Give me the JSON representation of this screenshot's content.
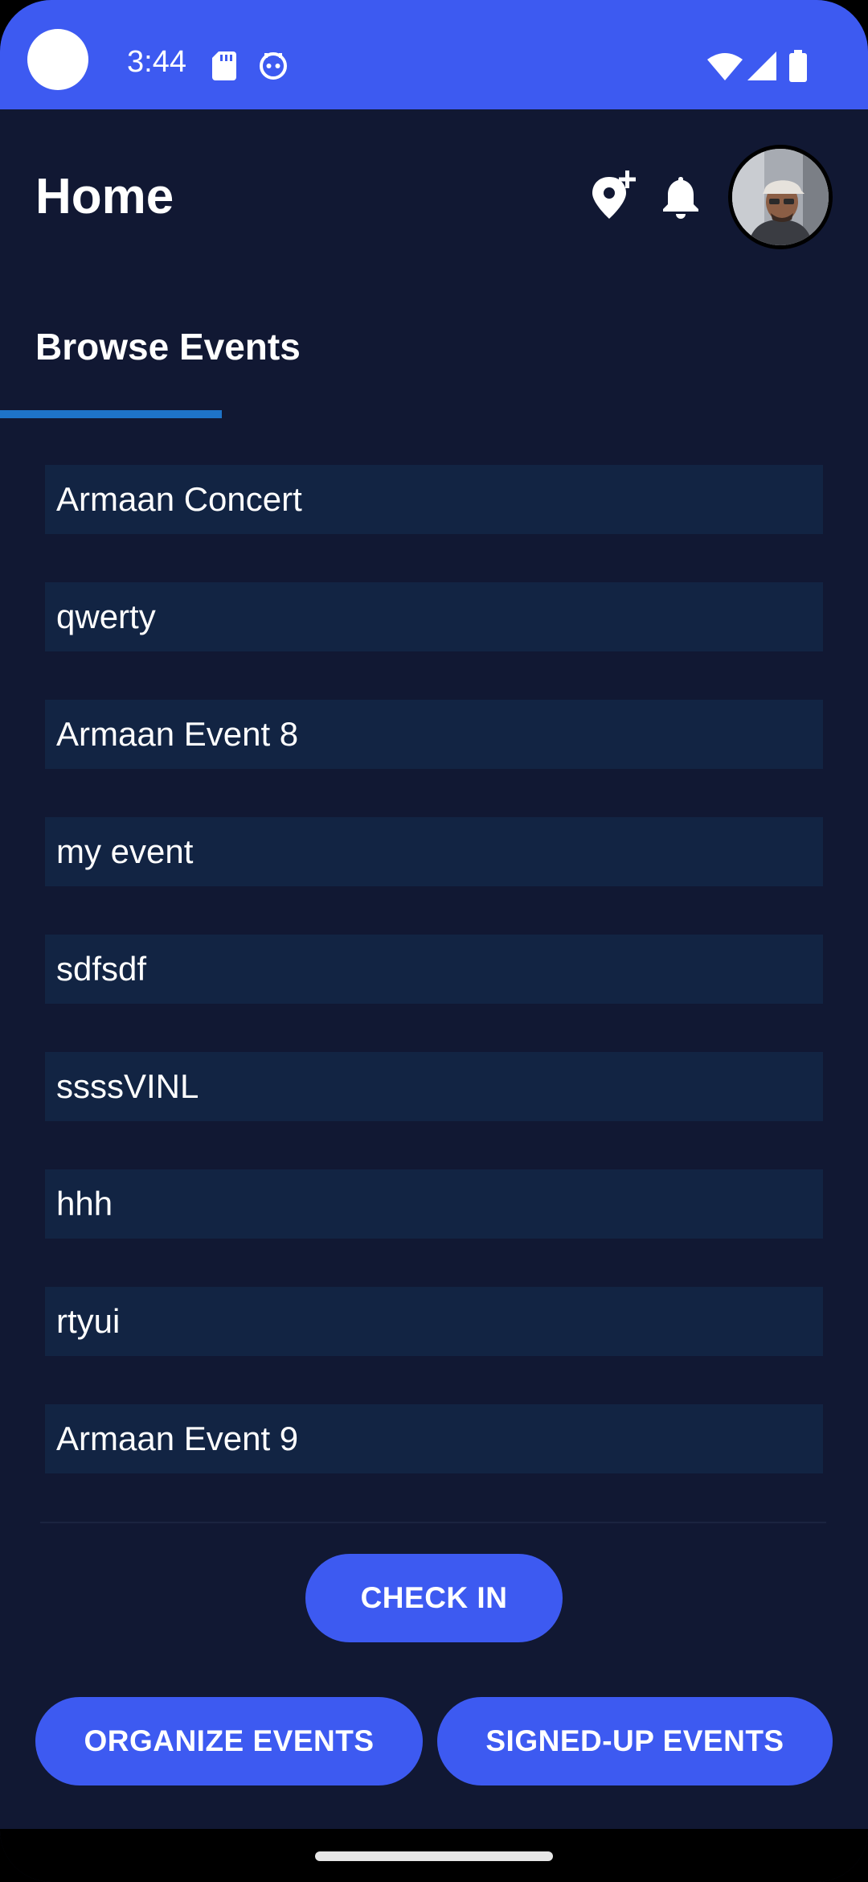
{
  "status_bar": {
    "time": "3:44",
    "icons": [
      "sd-card-icon",
      "bot-icon",
      "wifi-icon",
      "signal-icon",
      "battery-icon"
    ],
    "background": "#3d5af1"
  },
  "header": {
    "title": "Home",
    "icons": [
      "add-location-icon",
      "bell-icon"
    ]
  },
  "tabs": {
    "active_label": "Browse Events",
    "indicator_color": "#1e73c8"
  },
  "events": [
    {
      "label": "Armaan Concert"
    },
    {
      "label": "qwerty"
    },
    {
      "label": "Armaan Event 8"
    },
    {
      "label": "my event"
    },
    {
      "label": "sdfsdf"
    },
    {
      "label": "ssssVINL"
    },
    {
      "label": "hhh"
    },
    {
      "label": "rtyui"
    },
    {
      "label": "Armaan Event 9"
    }
  ],
  "actions": {
    "check_in": "CHECK IN",
    "organize": "ORGANIZE EVENTS",
    "signed_up": "SIGNED-UP EVENTS"
  },
  "colors": {
    "background": "#111833",
    "list_item": "#122443",
    "accent": "#3d5af1"
  }
}
